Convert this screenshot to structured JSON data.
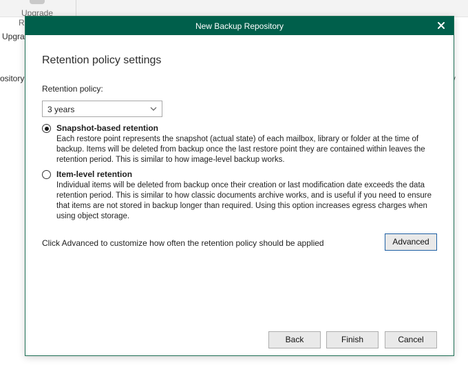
{
  "background": {
    "ribbon_label_upgrade": "Upgrade",
    "ribbon_label_r": "R",
    "ribbon_label_upgra": "Upgra",
    "sidebar_fragment": "ository",
    "right_fragment": "y"
  },
  "dialog": {
    "title": "New Backup Repository",
    "heading": "Retention policy settings",
    "retention_label": "Retention policy:",
    "retention_value": "3 years",
    "options": [
      {
        "title": "Snapshot-based retention",
        "checked": true,
        "description": "Each restore point represents the snapshot (actual state) of each mailbox, library or folder at the time of backup. Items will be deleted from backup once the last restore point they are contained within leaves the retention period. This is similar to how image-level backup works."
      },
      {
        "title": "Item-level retention",
        "checked": false,
        "description": "Individual items will be deleted from backup once their creation or last modification date exceeds the data retention period. This is similar to how classic documents archive works, and is useful if you need to ensure that items are not stored in backup longer than required. Using this option increases egress charges when using object storage."
      }
    ],
    "advanced_hint": "Click Advanced to customize how often the retention policy should be applied",
    "advanced_label": "Advanced",
    "back_label": "Back",
    "finish_label": "Finish",
    "cancel_label": "Cancel"
  },
  "colors": {
    "titlebar": "#005f4b",
    "focus_border": "#1d5fa3",
    "button_bg": "#e9e9e9"
  },
  "icons": {
    "close": "close-icon",
    "dropdown": "chevron-down-icon",
    "upgrade": "upgrade-icon"
  }
}
